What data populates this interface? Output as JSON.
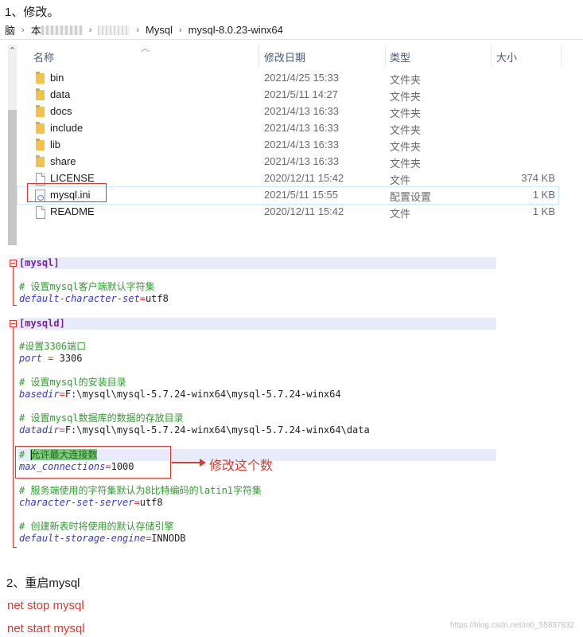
{
  "steps": {
    "step1": "1、修改。",
    "step2": "2、重启mysql"
  },
  "breadcrumb": {
    "items": [
      "脑",
      "本",
      "Mysql",
      "mysql-8.0.23-winx64"
    ]
  },
  "explorer": {
    "columns": {
      "name": "名称",
      "date": "修改日期",
      "type": "类型",
      "size": "大小"
    },
    "files": [
      {
        "icon": "folder-icon",
        "name": "bin",
        "date": "2021/4/25 15:33",
        "type": "文件夹",
        "size": ""
      },
      {
        "icon": "folder-icon",
        "name": "data",
        "date": "2021/5/11 14:27",
        "type": "文件夹",
        "size": ""
      },
      {
        "icon": "folder-icon",
        "name": "docs",
        "date": "2021/4/13 16:33",
        "type": "文件夹",
        "size": ""
      },
      {
        "icon": "folder-icon",
        "name": "include",
        "date": "2021/4/13 16:33",
        "type": "文件夹",
        "size": ""
      },
      {
        "icon": "folder-icon",
        "name": "lib",
        "date": "2021/4/13 16:33",
        "type": "文件夹",
        "size": ""
      },
      {
        "icon": "folder-icon",
        "name": "share",
        "date": "2021/4/13 16:33",
        "type": "文件夹",
        "size": ""
      },
      {
        "icon": "file-icon",
        "name": "LICENSE",
        "date": "2020/12/11 15:42",
        "type": "文件",
        "size": "374 KB"
      },
      {
        "icon": "ini-icon",
        "name": "mysql.ini",
        "date": "2021/5/11 15:55",
        "type": "配置设置",
        "size": "1 KB"
      },
      {
        "icon": "file-icon",
        "name": "README",
        "date": "2020/12/11 15:42",
        "type": "文件",
        "size": "1 KB"
      }
    ]
  },
  "config": {
    "sec_mysql": "[mysql]",
    "c1": "# 设置mysql客户端默认字符集",
    "k1": "default-character-set",
    "v1": "utf8",
    "sec_mysqld": "[mysqld]",
    "c2": "#设置3306端口",
    "k2": "port",
    "eq2": " = ",
    "v2": "3306",
    "c3": "# 设置mysql的安装目录",
    "k3": "basedir",
    "v3": "F:\\mysql\\mysql-5.7.24-winx64\\mysql-5.7.24-winx64",
    "c4": "# 设置mysql数据库的数据的存放目录",
    "k4": "datadir",
    "v4": "F:\\mysql\\mysql-5.7.24-winx64\\mysql-5.7.24-winx64\\data",
    "c5_hash": "# ",
    "c5_text": "允许最大连接数",
    "k5": "max_connections",
    "v5": "1000",
    "c6": "# 服务端使用的字符集默认为8比特编码的latin1字符集",
    "k6": "character-set-server",
    "v6": "utf8",
    "c7": "# 创建新表时将使用的默认存储引擎",
    "k7": "default-storage-engine",
    "v7": "INNODB",
    "eq": "="
  },
  "annotation": "修改这个数",
  "commands": [
    "net stop mysql",
    "net start mysql"
  ],
  "watermark": "https://blog.csdn.net/m0_55837832",
  "colors": {
    "accent_red": "#e0382e",
    "comment_green": "#2f9e2f",
    "key_blue": "#3a3ad0",
    "section_purple": "#7a1fa2"
  }
}
